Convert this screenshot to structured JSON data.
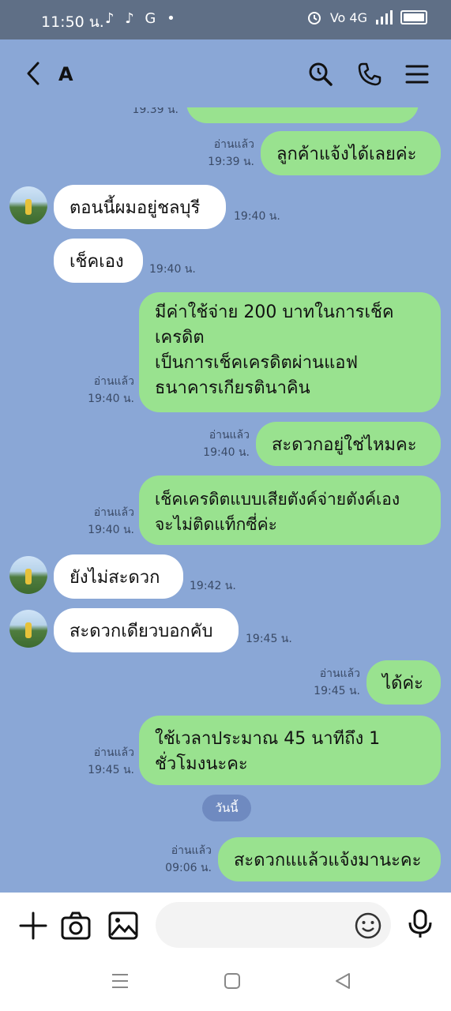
{
  "status": {
    "time": "11:50 น.",
    "left_icons": "♪ ♪ G •",
    "right_text": "Vo 4G"
  },
  "header": {
    "title": "A"
  },
  "messages": {
    "m0": {
      "time": "19.39 น."
    },
    "m1": {
      "text": "ลูกค้าแจ้งได้เลยค่ะ",
      "read": "อ่านแล้ว",
      "time": "19:39 น."
    },
    "m2": {
      "text": "ตอนนี้ผมอยู่ชลบุรี",
      "time": "19:40 น."
    },
    "m3": {
      "text": "เช็คเอง",
      "time": "19:40 น."
    },
    "m4": {
      "lines": [
        "มีค่าใช้จ่าย 200 บาทในการเช็ค",
        "เครดิต",
        "เป็นการเช็คเครดิตผ่านแอฟ",
        "ธนาคารเกียรตินาคิน"
      ],
      "read": "อ่านแล้ว",
      "time": "19:40 น."
    },
    "m5": {
      "text": "สะดวกอยู่ใช่ไหมคะ",
      "read": "อ่านแล้ว",
      "time": "19:40 น."
    },
    "m6": {
      "lines": [
        "เช็คเครดิตแบบเสียตังค์จ่ายตังค์เอง",
        "จะไม่ติดแท็กซี่ค่ะ"
      ],
      "read": "อ่านแล้ว",
      "time": "19:40 น."
    },
    "m7": {
      "text": "ยังไม่สะดวก",
      "time": "19:42 น."
    },
    "m8": {
      "text": "สะดวกเดียวบอกคับ",
      "time": "19:45 น."
    },
    "m9": {
      "text": "ได้ค่ะ",
      "read": "อ่านแล้ว",
      "time": "19:45 น."
    },
    "m10": {
      "lines": [
        "ใช้เวลาประมาณ 45 นาทีถึง 1",
        "ชั่วโมงนะคะ"
      ],
      "read": "อ่านแล้ว",
      "time": "19:45 น."
    },
    "date_chip": "วันนี้",
    "m11": {
      "text": "สะดวกแแล้วแจ้งมานะคะ",
      "read": "อ่านแล้ว",
      "time": "09:06 น."
    }
  },
  "colors": {
    "sent_bubble": "#99e28f",
    "recv_bubble": "#ffffff",
    "chat_background": "#8aa7d6",
    "status_bar": "#5f6f86"
  }
}
